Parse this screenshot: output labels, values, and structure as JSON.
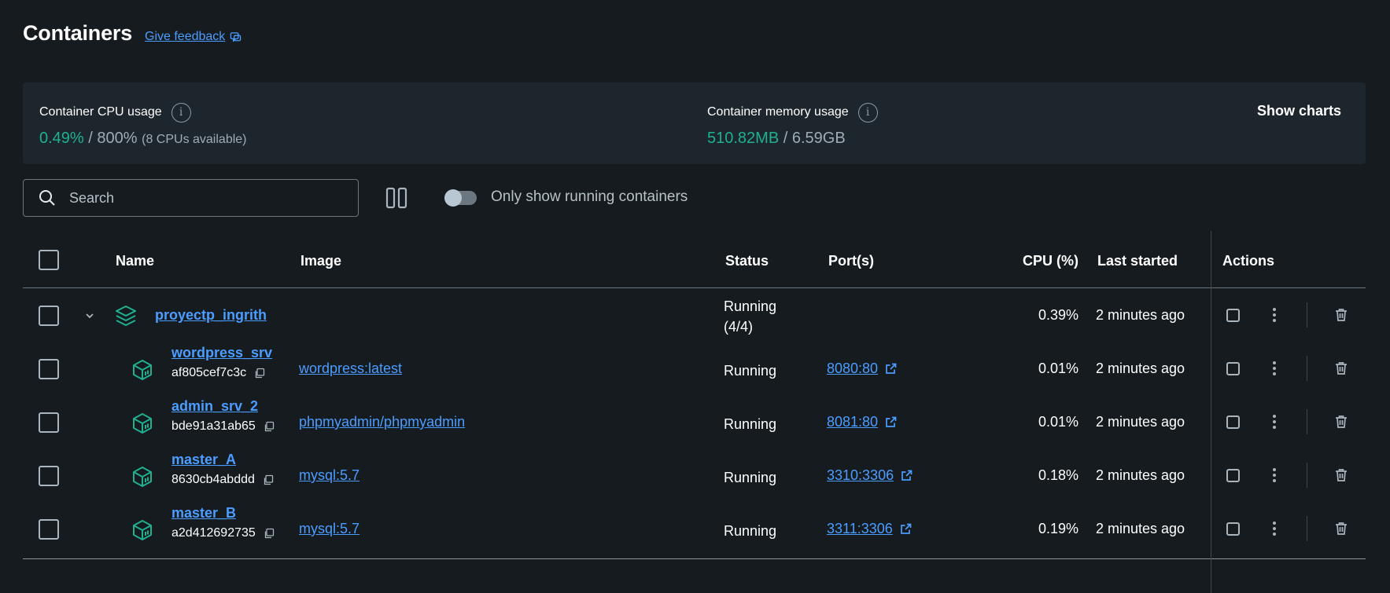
{
  "header": {
    "title": "Containers",
    "feedback_label": "Give feedback"
  },
  "stats": {
    "cpu_label": "Container CPU usage",
    "cpu_used": "0.49%",
    "cpu_sep": " / ",
    "cpu_total": "800%",
    "cpu_note": "(8 CPUs available)",
    "mem_label": "Container memory usage",
    "mem_used": "510.82MB",
    "mem_sep": " / ",
    "mem_total": "6.59GB",
    "show_charts": "Show charts"
  },
  "toolbar": {
    "search_placeholder": "Search",
    "toggle_label": "Only show running containers",
    "toggle_on": false
  },
  "table": {
    "columns": {
      "name": "Name",
      "image": "Image",
      "status": "Status",
      "ports": "Port(s)",
      "cpu": "CPU (%)",
      "last_started": "Last started",
      "actions": "Actions"
    },
    "group": {
      "name": "proyectp_ingrith",
      "status_line1": "Running",
      "status_line2": "(4/4)",
      "cpu": "0.39%",
      "last_started": "2 minutes ago"
    },
    "rows": [
      {
        "name": "wordpress_srv",
        "id": "af805cef7c3c",
        "image": "wordpress:latest",
        "status": "Running",
        "port": "8080:80",
        "cpu": "0.01%",
        "last_started": "2 minutes ago"
      },
      {
        "name": "admin_srv_2",
        "id": "bde91a31ab65",
        "image": "phpmyadmin/phpmyadmin",
        "status": "Running",
        "port": "8081:80",
        "cpu": "0.01%",
        "last_started": "2 minutes ago"
      },
      {
        "name": "master_A",
        "id": "8630cb4abddd",
        "image": "mysql:5.7",
        "status": "Running",
        "port": "3310:3306",
        "cpu": "0.18%",
        "last_started": "2 minutes ago"
      },
      {
        "name": "master_B",
        "id": "a2d412692735",
        "image": "mysql:5.7",
        "status": "Running",
        "port": "3311:3306",
        "cpu": "0.19%",
        "last_started": "2 minutes ago"
      }
    ]
  },
  "colors": {
    "background": "#151b1f",
    "panel": "#1e262d",
    "accent_link": "#4b9dff",
    "usage_green": "#1fb18f",
    "container_icon": "#1fb18f"
  },
  "icons": {
    "feedback": "chat-bubble-icon",
    "info": "info-circle-icon",
    "search": "search-icon",
    "columns": "columns-icon",
    "stack": "compose-stack-icon",
    "container": "container-cube-icon",
    "copy": "copy-icon",
    "external": "external-link-icon",
    "chevron": "chevron-down-icon",
    "stop": "stop-icon",
    "more": "kebab-menu-icon",
    "delete": "trash-icon"
  }
}
